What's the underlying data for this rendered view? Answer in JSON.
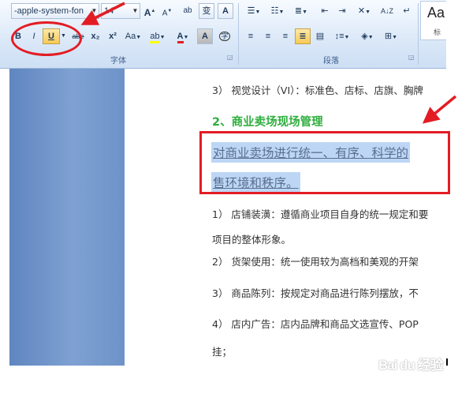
{
  "ribbon": {
    "font_group": {
      "label": "字体",
      "font_name": "-apple-system-fon",
      "font_size": "14",
      "grow_font": "A",
      "shrink_font": "A",
      "clear_format": "ab",
      "phonetic": "变",
      "border_char": "A",
      "bold": "B",
      "italic": "I",
      "underline": "U",
      "strikethrough": "abe",
      "subscript": "x₂",
      "superscript": "x²",
      "change_case": "Aa",
      "highlight": "ab",
      "font_color": "A",
      "char_shading": "A",
      "enclose_char": "字"
    },
    "paragraph_group": {
      "label": "段落",
      "sort": "A↓Z"
    },
    "styles": {
      "sample": "Aa",
      "sub": "标"
    }
  },
  "document": {
    "line1": "3） 视觉设计（VI）：标准色、店标、店旗、胸牌",
    "heading": "2、商业卖场现场管理",
    "selected_line1": "对商业卖场进行统一、有序、科学的",
    "selected_line2": "售环境和秩序。",
    "line_a": "1） 店铺装潢：遵循商业项目自身的统一规定和要",
    "line_b": "项目的整体形象。",
    "line_c": "2） 货架使用：统一使用较为高档和美观的开架",
    "line_d": "3） 商品陈列：按规定对商品进行陈列摆放，不",
    "line_e": "4） 店内广告：店内品牌和商品文选宣传、POP",
    "line_f": "挂；"
  },
  "watermark": {
    "text": "Bai du 经验"
  },
  "colors": {
    "annotation_red": "#e31c24",
    "heading_green": "#2fae3e",
    "selection_blue": "#bdd6f5",
    "left_pane_blue": "#6e93c8"
  }
}
